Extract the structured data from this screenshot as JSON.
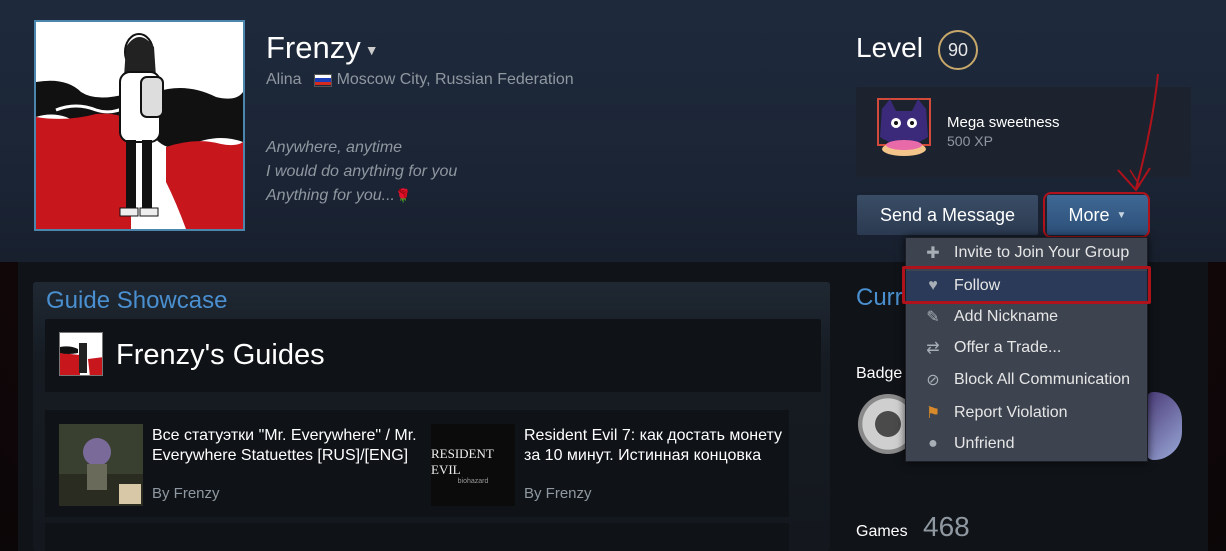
{
  "profile": {
    "persona_name": "Frenzy",
    "real_name": "Alina",
    "location": "Moscow City, Russian Federation",
    "summary_lines": [
      "Anywhere, anytime",
      "I would do anything for you",
      "Anything for you..."
    ],
    "level_label": "Level",
    "level": "90"
  },
  "featured_badge": {
    "name": "Mega sweetness",
    "xp": "500 XP"
  },
  "actions": {
    "send_message": "Send a Message",
    "more": "More"
  },
  "more_menu": [
    {
      "label": "Invite to Join Your Group",
      "icon": "invite-group-icon"
    },
    {
      "label": "Follow",
      "icon": "heart-icon"
    },
    {
      "label": "Add Nickname",
      "icon": "pencil-icon"
    },
    {
      "label": "Offer a Trade...",
      "icon": "trade-arrows-icon"
    },
    {
      "label": "Block All Communication",
      "icon": "block-icon"
    },
    {
      "label": "Report Violation",
      "icon": "flag-icon"
    },
    {
      "label": "Unfriend",
      "icon": "person-icon"
    }
  ],
  "showcase": {
    "title": "Guide Showcase",
    "guides_header": "Frenzy's Guides",
    "guides": [
      {
        "title": "Все статуэтки \"Mr. Everywhere\" / Mr. Everywhere Statuettes [RUS]/[ENG]",
        "by": "By Frenzy"
      },
      {
        "title": "Resident Evil 7: как достать монету за 10 минут. Истинная концовка",
        "by": "By Frenzy",
        "thumb_text": "RESIDENT EVIL",
        "thumb_subtext": "biohazard"
      }
    ]
  },
  "sidebar": {
    "current_label": "Curr",
    "badges_label": "Badge",
    "games_label": "Games",
    "games_count": "468"
  },
  "colors": {
    "highlight_red": "#b0121b",
    "accent_blue": "#4a8fcf",
    "level_ring": "#c8a86a"
  }
}
